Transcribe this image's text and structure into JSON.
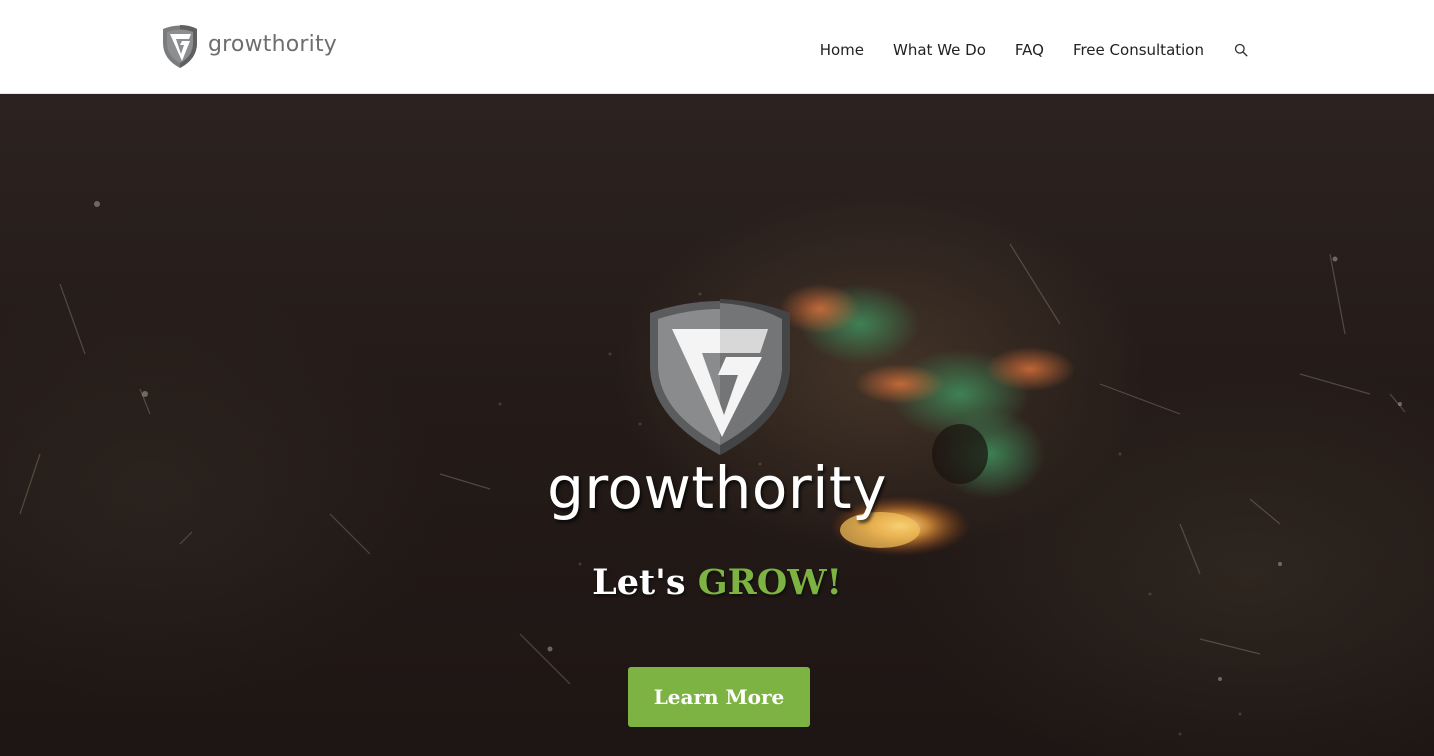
{
  "header": {
    "brand_name": "growthority",
    "logo_icon": "growthority-shield-logo",
    "nav": [
      {
        "label": "Home"
      },
      {
        "label": "What We Do"
      },
      {
        "label": "FAQ"
      },
      {
        "label": "Free Consultation"
      }
    ],
    "search_icon": "search-icon"
  },
  "hero": {
    "logo_icon": "growthority-shield-logo",
    "title": "growthority",
    "tagline_prefix": "Let's",
    "tagline_accent": "GROW!",
    "cta_label": "Learn More"
  },
  "colors": {
    "accent_green": "#7cb342",
    "header_bg": "#ffffff",
    "brand_gray": "#6d6e70",
    "hero_dark": "#241b18"
  }
}
